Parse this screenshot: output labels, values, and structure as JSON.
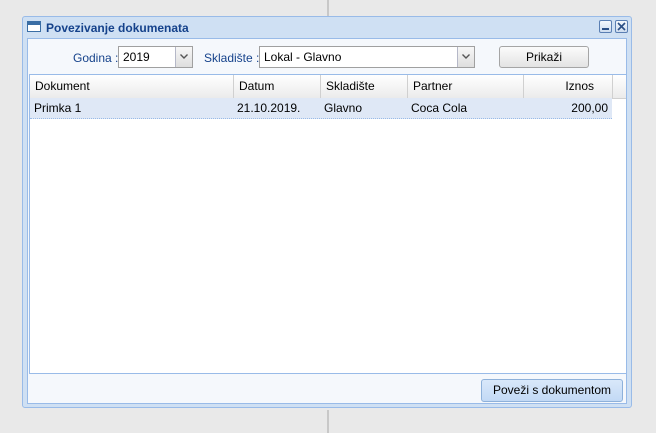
{
  "window": {
    "title": "Povezivanje dokumenata"
  },
  "filters": {
    "year_label": "Godina :",
    "year_value": "2019",
    "warehouse_label": "Skladište :",
    "warehouse_value": "Lokal - Glavno",
    "show_button": "Prikaži"
  },
  "grid": {
    "columns": [
      "Dokument",
      "Datum",
      "Skladište",
      "Partner",
      "Iznos"
    ],
    "rows": [
      {
        "dokument": "Primka 1",
        "datum": "21.10.2019.",
        "skladiste": "Glavno",
        "partner": "Coca Cola",
        "iznos": "200,00"
      }
    ]
  },
  "footer": {
    "link_button": "Poveži s dokumentom"
  },
  "colors": {
    "accent": "#15428b",
    "border": "#99bbe8",
    "selected_row": "#dfe8f6"
  },
  "icons": [
    "window-icon",
    "minimize-icon",
    "close-icon",
    "chevron-down-icon"
  ]
}
